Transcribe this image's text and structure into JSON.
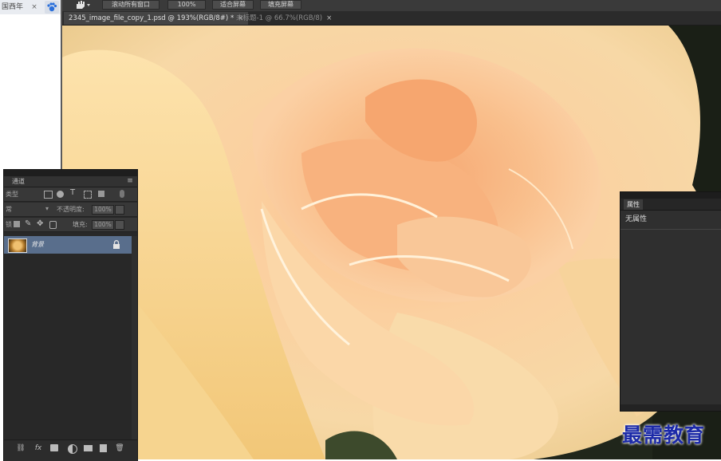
{
  "browser": {
    "tab_label": "国西年",
    "tab_close": "×"
  },
  "options_bar": {
    "scroll_all_label": "滚动所有窗口",
    "zoom_100_label": "100%",
    "fit_screen_label": "适合屏幕",
    "fill_screen_label": "填充屏幕"
  },
  "doc_tabs": [
    {
      "label": "2345_image_file_copy_1.psd @ 193%(RGB/8#) *",
      "close": "×"
    },
    {
      "label": "未标题-1 @ 66.7%(RGB/8)",
      "close": "×"
    }
  ],
  "layers_panel": {
    "channels_tab": "通道",
    "menu_icon": "≡",
    "filter_label": "类型",
    "blend_mode": "常",
    "opacity_label": "不透明度:",
    "opacity_value": "100%",
    "lock_label": "锁",
    "fill_label": "填充:",
    "fill_value": "100%",
    "layer_name": "背景",
    "footer_icons": [
      "link-icon",
      "fx-icon",
      "mask-icon",
      "adjustment-icon",
      "folder-icon",
      "new-layer-icon",
      "trash-icon"
    ],
    "fx_text": "fx"
  },
  "properties_panel": {
    "tab_label": "属性",
    "message": "无属性"
  },
  "watermark": {
    "text": "最需教育"
  },
  "colors": {
    "ui_dark": "#282828",
    "selected_layer": "#596e8c",
    "watermark": "#1c2aa8"
  }
}
